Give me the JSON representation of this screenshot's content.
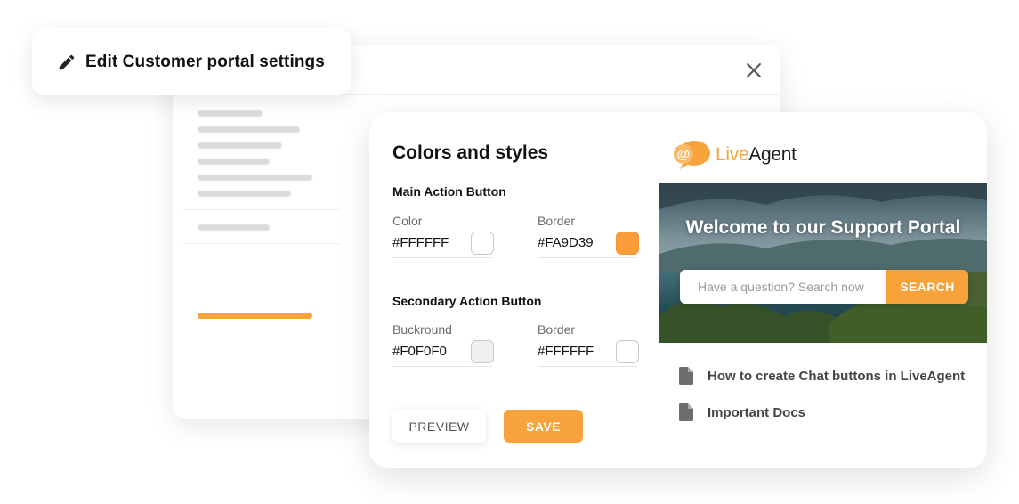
{
  "title_card": {
    "icon": "pencil-icon",
    "title": "Edit Customer portal settings"
  },
  "modal": {
    "close_icon": "close-icon"
  },
  "settings": {
    "heading": "Colors and styles",
    "main_action": {
      "title": "Main Action Button",
      "color_label": "Color",
      "color_value": "#FFFFFF",
      "border_label": "Border",
      "border_value": "#FA9D39"
    },
    "secondary_action": {
      "title": "Secondary Action Button",
      "background_label": "Buckround",
      "background_value": "#F0F0F0",
      "border_label": "Border",
      "border_value": "#FFFFFF"
    },
    "preview_label": "PREVIEW",
    "save_label": "SAVE"
  },
  "portal": {
    "logo_text_orange": "Live",
    "logo_text_dark": "Agent",
    "hero_title": "Welcome to our Support Portal",
    "search_placeholder": "Have a question? Search now",
    "search_button": "SEARCH",
    "links": [
      {
        "label": "How to create Chat buttons in LiveAgent",
        "icon": "document-icon"
      },
      {
        "label": "Important Docs",
        "icon": "document-icon"
      }
    ]
  },
  "colors": {
    "accent": "#F7A23B",
    "swatch_main_color": "#FFFFFF",
    "swatch_main_border": "#FA9D39",
    "swatch_secondary_bg": "#F0F0F0",
    "swatch_secondary_border": "#FFFFFF"
  }
}
